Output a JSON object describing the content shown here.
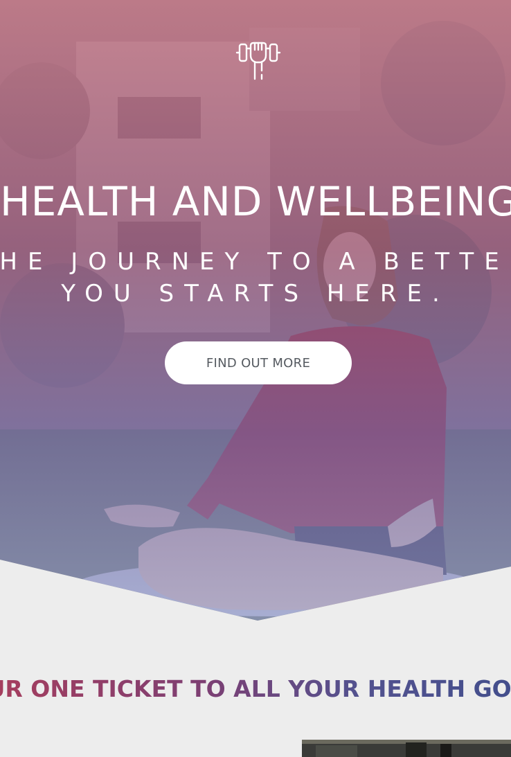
{
  "hero": {
    "logo_icon": "hand-lifting-dumbbell-icon",
    "title": "HEALTH AND WELLBEING",
    "subtitle": "THE JOURNEY TO A BETTER YOU STARTS HERE.",
    "cta_label": "FIND OUT MORE"
  },
  "intro": {
    "tagline": "YOUR ONE TICKET TO ALL YOUR HEALTH GOALS"
  },
  "colors": {
    "background": "#ededed",
    "hero_overlay_top": "#c97a8a",
    "hero_overlay_bottom": "#969fd2",
    "tagline_gradient_start": "#a53e5e",
    "tagline_gradient_end": "#434e8c",
    "cta_text": "#555a60"
  }
}
